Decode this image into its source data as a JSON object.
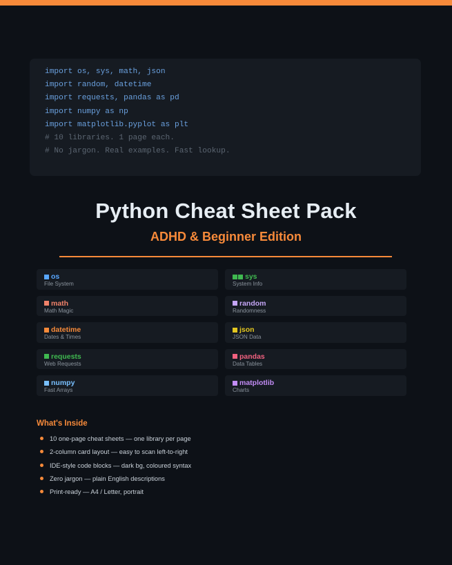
{
  "colors": {
    "accent": "#f78a3a",
    "background": "#0d1117",
    "card": "#161b22",
    "code_keyword": "#6aa0de",
    "code_comment": "#5c6672"
  },
  "code": {
    "lines": [
      {
        "text": "import os, sys, math, json",
        "kind": "code"
      },
      {
        "text": "import random, datetime",
        "kind": "code"
      },
      {
        "text": "import requests, pandas as pd",
        "kind": "code"
      },
      {
        "text": "import numpy as np",
        "kind": "code"
      },
      {
        "text": "import matplotlib.pyplot as plt",
        "kind": "code"
      },
      {
        "text": "# 10 libraries. 1 page each.",
        "kind": "comment"
      },
      {
        "text": "# No jargon. Real examples. Fast lookup.",
        "kind": "comment"
      }
    ]
  },
  "header": {
    "title": "Python Cheat Sheet Pack",
    "subtitle": "ADHD & Beginner Edition"
  },
  "libraries": [
    {
      "name": "os",
      "desc": "File System",
      "color": "#58a6ff",
      "double": false
    },
    {
      "name": "sys",
      "desc": "System Info",
      "color": "#3fb950",
      "double": true
    },
    {
      "name": "math",
      "desc": "Math Magic",
      "color": "#f0826a",
      "double": false
    },
    {
      "name": "random",
      "desc": "Randomness",
      "color": "#c4a5f5",
      "double": false
    },
    {
      "name": "datetime",
      "desc": "Dates & Times",
      "color": "#f78a3a",
      "double": false
    },
    {
      "name": "json",
      "desc": "JSON Data",
      "color": "#e3c620",
      "double": false
    },
    {
      "name": "requests",
      "desc": "Web Requests",
      "color": "#3fb950",
      "double": false
    },
    {
      "name": "pandas",
      "desc": "Data Tables",
      "color": "#f0617f",
      "double": false
    },
    {
      "name": "numpy",
      "desc": "Fast Arrays",
      "color": "#79c0ff",
      "double": false
    },
    {
      "name": "matplotlib",
      "desc": "Charts",
      "color": "#c28cf5",
      "double": false
    }
  ],
  "inside": {
    "heading": "What's Inside",
    "items": [
      "10 one-page cheat sheets — one library per page",
      "2-column card layout — easy to scan left-to-right",
      "IDE-style code blocks — dark bg, coloured syntax",
      "Zero jargon — plain English descriptions",
      "Print-ready — A4 / Letter, portrait"
    ]
  }
}
